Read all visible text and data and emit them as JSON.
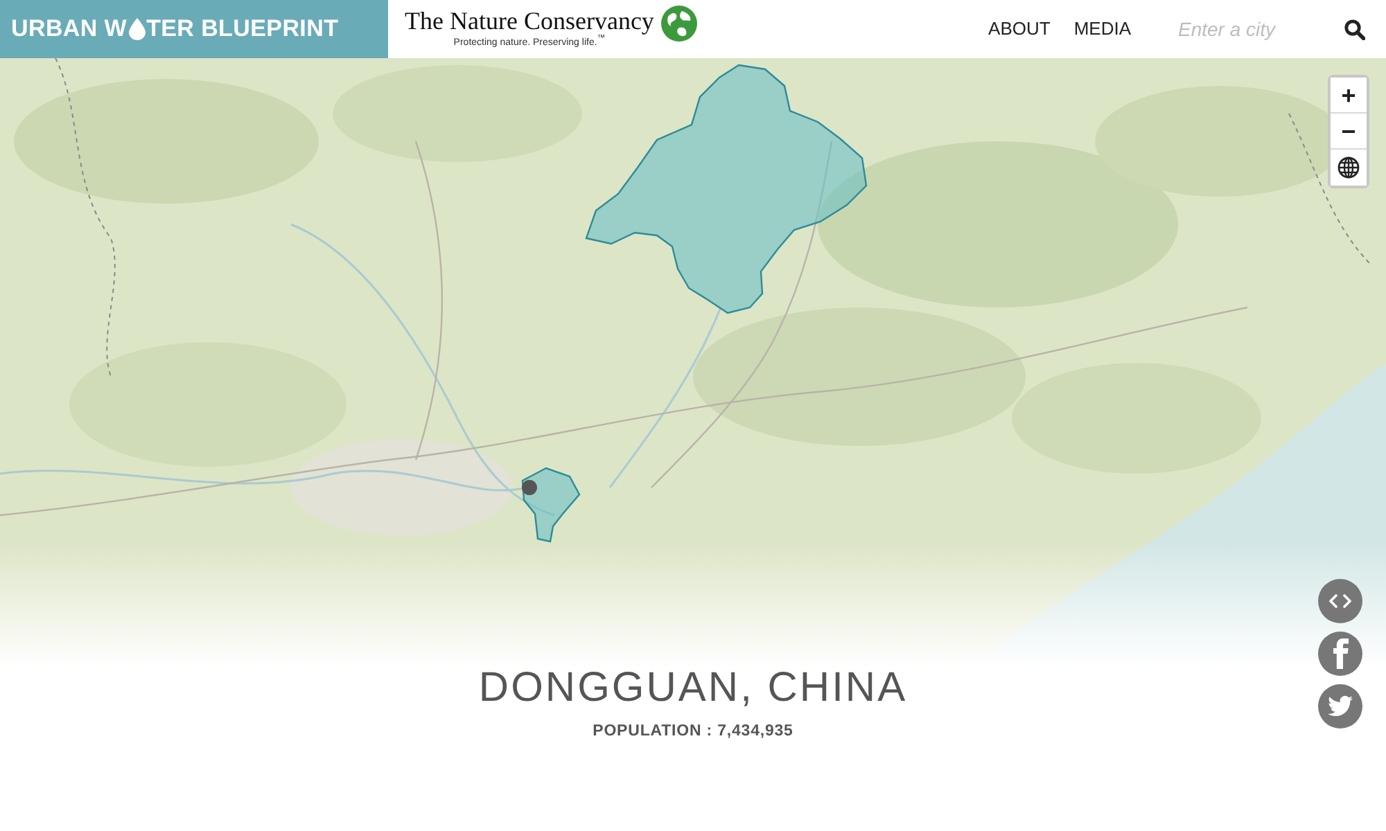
{
  "header": {
    "brand": {
      "title_before": "URBAN W",
      "title_after": "TER BLUEPRINT"
    },
    "partner": {
      "name": "The Nature Conservancy",
      "tagline": "Protecting nature. Preserving life.$^{™}$"
    },
    "nav": [
      {
        "label": "ABOUT"
      },
      {
        "label": "MEDIA"
      }
    ],
    "search": {
      "placeholder": "Enter a city"
    }
  },
  "map": {
    "zoom_controls": [
      {
        "kind": "zoom-in",
        "label": "+"
      },
      {
        "kind": "zoom-out",
        "label": "−"
      },
      {
        "kind": "basemap"
      }
    ],
    "share_buttons": [
      {
        "kind": "embed"
      },
      {
        "kind": "facebook"
      },
      {
        "kind": "twitter"
      }
    ]
  },
  "city": {
    "title": "DONGGUAN, CHINA",
    "population": "POPULATION : 7,434,935"
  }
}
